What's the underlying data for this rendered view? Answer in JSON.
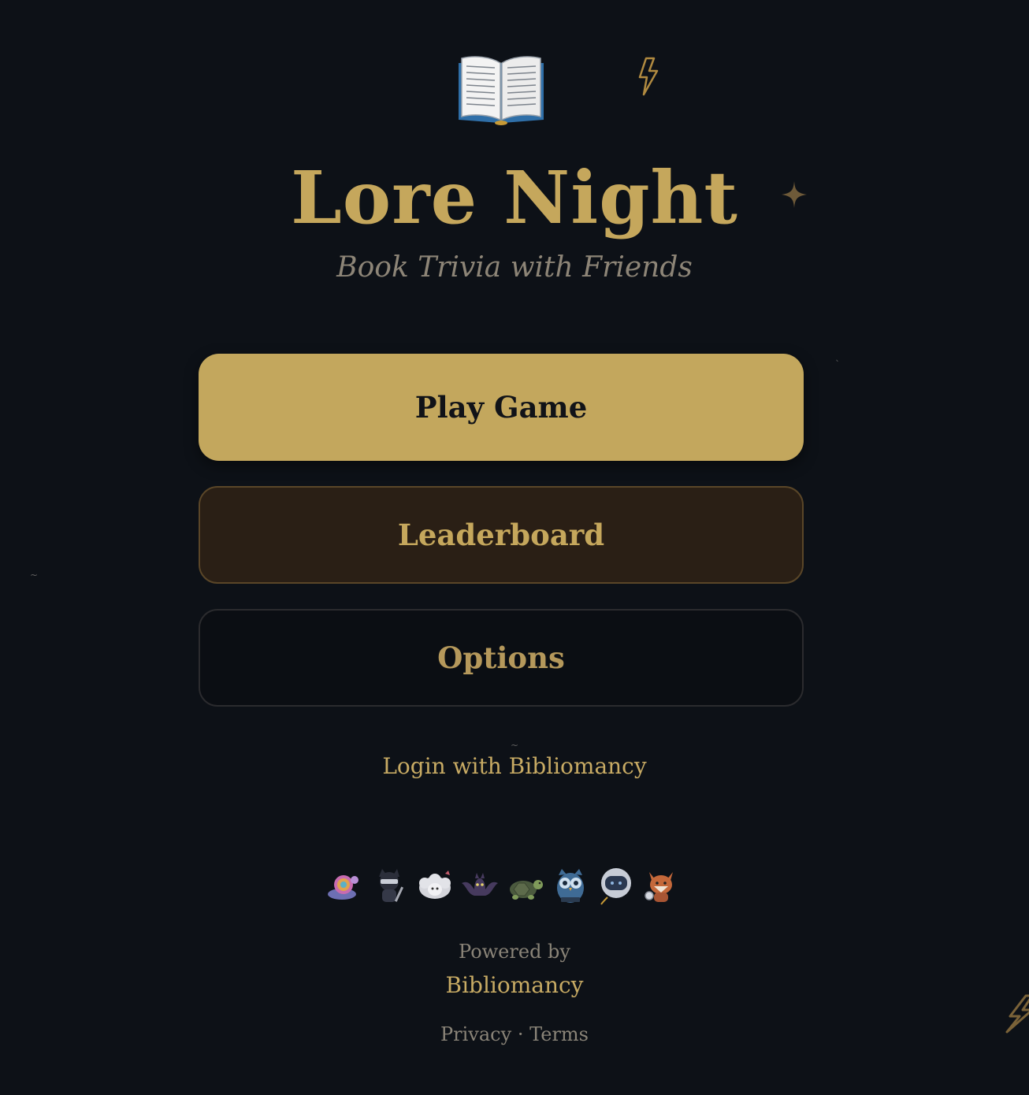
{
  "hero": {
    "logo_icon": "open-book-icon",
    "title": "Lore Night",
    "subtitle": "Book Trivia with Friends"
  },
  "menu": {
    "play_label": "Play Game",
    "leaderboard_label": "Leaderboard",
    "options_label": "Options"
  },
  "auth": {
    "login_label": "Login with Bibliomancy"
  },
  "avatars": [
    {
      "name": "rainbow-snail-avatar"
    },
    {
      "name": "ninja-cat-avatar"
    },
    {
      "name": "sheep-avatar"
    },
    {
      "name": "bat-avatar"
    },
    {
      "name": "turtle-avatar"
    },
    {
      "name": "owl-avatar"
    },
    {
      "name": "astronaut-avatar"
    },
    {
      "name": "fox-avatar"
    }
  ],
  "footer": {
    "powered_by": "Powered by",
    "brand": "Bibliomancy",
    "privacy": "Privacy",
    "separator": "·",
    "terms": "Terms"
  },
  "colors": {
    "background": "#0d1117",
    "gold": "#c5a75c",
    "play_button": "#c3a75d",
    "leaderboard_button": "#2a1f15",
    "muted_text": "#8a8478"
  }
}
